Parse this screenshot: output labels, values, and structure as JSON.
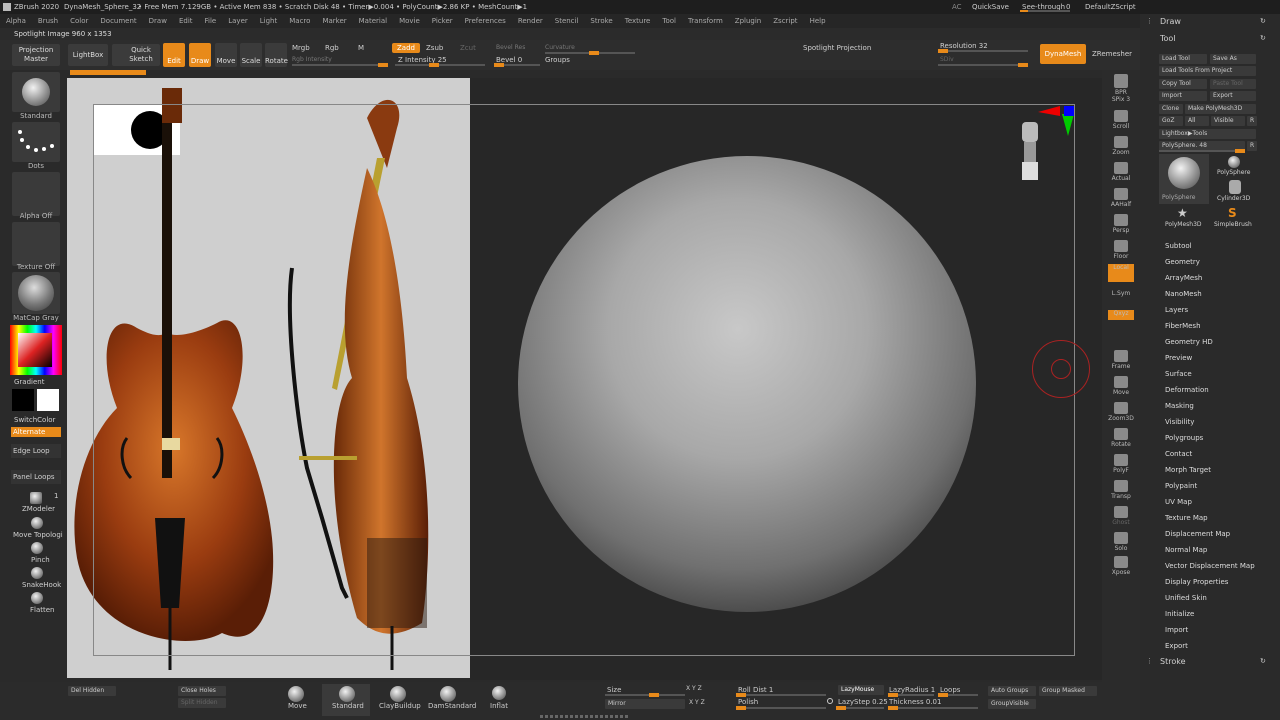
{
  "title": {
    "app": "ZBrush 2020",
    "tool_name": "DynaMesh_Sphere_32",
    "stats": "• Free Mem 7.129GB • Active Mem 838 • Scratch Disk 48 • Timer▶0.004 • PolyCount▶2.86 KP • MeshCount▶1",
    "ac": "AC",
    "quicksave": "QuickSave",
    "seethrough": "See-through",
    "seethrough_val": "0",
    "script": "DefaultZScript"
  },
  "menu": [
    "Alpha",
    "Brush",
    "Color",
    "Document",
    "Draw",
    "Edit",
    "File",
    "Layer",
    "Light",
    "Macro",
    "Marker",
    "Material",
    "Movie",
    "Picker",
    "Preferences",
    "Render",
    "Stencil",
    "Stroke",
    "Texture",
    "Tool",
    "Transform",
    "Zplugin",
    "Zscript",
    "Help"
  ],
  "spotlight_text": "Spotlight Image 960 x 1353",
  "toolbar": {
    "projection_master": "Projection Master",
    "lightbox": "LightBox",
    "quick_sketch": "Quick Sketch",
    "edit": "Edit",
    "draw": "Draw",
    "move": "Move",
    "scale": "Scale",
    "rotate": "Rotate",
    "mrgb": "Mrgb",
    "rgb": "Rgb",
    "m": "M",
    "rgb_intensity": "Rgb Intensity",
    "zadd": "Zadd",
    "zsub": "Zsub",
    "zcut": "Zcut",
    "z_intensity": "Z Intensity 25",
    "bevel_res": "Bevel Res",
    "bevel": "Bevel 0",
    "curvature": "Curvature",
    "groups": "Groups",
    "spotlight_projection": "Spotlight Projection",
    "resolution": "Resolution 32",
    "sdiv": "SDiv",
    "dynamesh": "DynaMesh",
    "zremesher": "ZRemesher"
  },
  "left": {
    "standard": "Standard",
    "dots": "Dots",
    "alpha_off": "Alpha Off",
    "texture_off": "Texture Off",
    "matcap": "MatCap Gray",
    "gradient": "Gradient",
    "switchcolor": "SwitchColor",
    "alternate": "Alternate",
    "edge_loop": "Edge Loop",
    "panel_loops": "Panel Loops",
    "zmodeler": "ZModeler",
    "zmodeler_num": "1",
    "move_topo": "Move Topologi",
    "pinch": "Pinch",
    "snakehook": "SnakeHook",
    "flatten": "Flatten"
  },
  "nav": [
    "BPR",
    "SPix 3",
    "Scroll",
    "Zoom",
    "Actual",
    "AAHalf",
    "Persp",
    "Floor",
    "Local",
    "L.Sym",
    "Qxyz",
    "Frame",
    "Move",
    "Zoom3D",
    "Rotate",
    "PolyF",
    "Transp",
    "Ghost",
    "Solo",
    "Xpose"
  ],
  "tool_panel": {
    "draw": "Draw",
    "tool": "Tool",
    "load_tool": "Load Tool",
    "save_as": "Save As",
    "load_from_project": "Load Tools From Project",
    "copy_tool": "Copy Tool",
    "paste_tool": "Paste Tool",
    "import": "Import",
    "export": "Export",
    "clone": "Clone",
    "make_polymesh": "Make PolyMesh3D",
    "goz": "GoZ",
    "all": "All",
    "visible": "Visible",
    "r": "R",
    "lightbox_tools": "Lightbox▶Tools",
    "polysphere_slider": "PolySphere. 48",
    "thumbs": [
      "PolySphere",
      "PolySphere",
      "Cylinder3D",
      "PolyMesh3D",
      "SimpleBrush"
    ],
    "items": [
      "Subtool",
      "Geometry",
      "ArrayMesh",
      "NanoMesh",
      "Layers",
      "FiberMesh",
      "Geometry HD",
      "Preview",
      "Surface",
      "Deformation",
      "Masking",
      "Visibility",
      "Polygroups",
      "Contact",
      "Morph Target",
      "Polypaint",
      "UV Map",
      "Texture Map",
      "Displacement Map",
      "Normal Map",
      "Vector Displacement Map",
      "Display Properties",
      "Unified Skin",
      "Initialize",
      "Import",
      "Export"
    ],
    "stroke": "Stroke"
  },
  "bottom": {
    "del_hidden": "Del Hidden",
    "close_holes": "Close Holes",
    "split_hidden": "Split Hidden",
    "brushes": [
      "Move",
      "Standard",
      "ClayBuildup",
      "DamStandard",
      "Inflat"
    ],
    "size": "Size",
    "xyz": "X Y Z",
    "mirror": "Mirror",
    "roll_dist": "Roll Dist 1",
    "polish": "Polish",
    "lazymouse": "LazyMouse",
    "lazyradius": "LazyRadius 1",
    "loops": "Loops",
    "lazystep": "LazyStep 0.25",
    "thickness": "Thickness 0.01",
    "auto_groups": "Auto Groups",
    "group_masked": "Group Masked",
    "group_visible": "GroupVisible"
  },
  "colors": {
    "accent": "#e88a1a",
    "panel": "#2a2a2a"
  }
}
